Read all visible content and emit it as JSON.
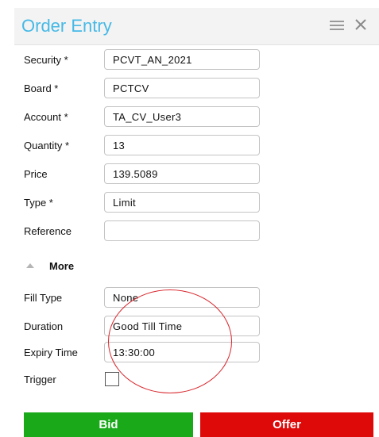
{
  "window": {
    "title": "Order Entry"
  },
  "icons": {
    "menu": "hamburger-menu-icon",
    "close": "close-icon",
    "more": "caret-up-icon"
  },
  "fields": [
    {
      "label": "Security *",
      "value": "PCVT_AN_2021"
    },
    {
      "label": "Board *",
      "value": "PCTCV"
    },
    {
      "label": "Account *",
      "value": "TA_CV_User3"
    },
    {
      "label": "Quantity *",
      "value": "13"
    },
    {
      "label": "Price",
      "value": "139.5089"
    },
    {
      "label": "Type *",
      "value": "Limit"
    },
    {
      "label": "Reference",
      "value": ""
    }
  ],
  "more": {
    "label": "More",
    "fields": [
      {
        "label": "Fill Type",
        "value": "None"
      },
      {
        "label": "Duration",
        "value": "Good Till Time"
      },
      {
        "label": "Expiry Time",
        "value": "13:30:00"
      }
    ],
    "trigger": {
      "label": "Trigger",
      "checked": false
    }
  },
  "actions": {
    "bid": "Bid",
    "offer": "Offer"
  },
  "colors": {
    "title": "#46b9e6",
    "bid": "#19a919",
    "offer": "#de0a0a",
    "annotation": "#d9252b"
  }
}
